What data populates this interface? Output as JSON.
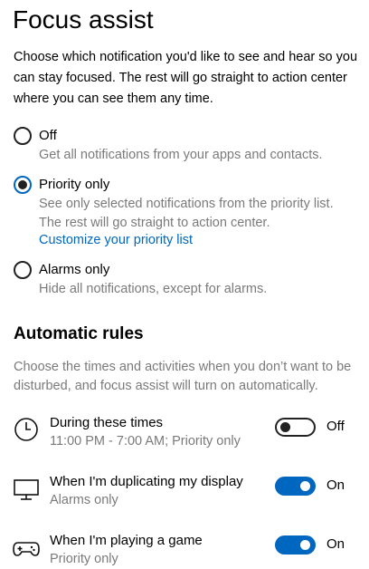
{
  "page": {
    "title": "Focus assist",
    "intro": "Choose which notification you'd like to see and hear so you can stay focused. The rest will go straight to action center where you can see them any time."
  },
  "options": [
    {
      "label": "Off",
      "desc": "Get all notifications from your apps and contacts.",
      "selected": false
    },
    {
      "label": "Priority only",
      "desc_line1": "See only selected notifications from the priority list.",
      "desc_line2": "The rest will go straight to action center.",
      "link": "Customize your priority list",
      "selected": true
    },
    {
      "label": "Alarms only",
      "desc": "Hide all notifications, except for alarms.",
      "selected": false
    }
  ],
  "automatic_rules": {
    "title": "Automatic rules",
    "desc": "Choose the times and activities when you don’t want to be disturbed, and focus assist will turn on automatically.",
    "rules": [
      {
        "icon": "clock-icon",
        "title": "During these times",
        "subtitle": "11:00 PM - 7:00 AM; Priority only",
        "state": "Off"
      },
      {
        "icon": "monitor-icon",
        "title": "When I'm duplicating my display",
        "subtitle": "Alarms only",
        "state": "On"
      },
      {
        "icon": "game-controller-icon",
        "title": "When I'm playing a game",
        "subtitle": "Priority only",
        "state": "On"
      }
    ]
  },
  "colors": {
    "accent": "#0067c0",
    "secondary_text": "#7a7a7a"
  }
}
